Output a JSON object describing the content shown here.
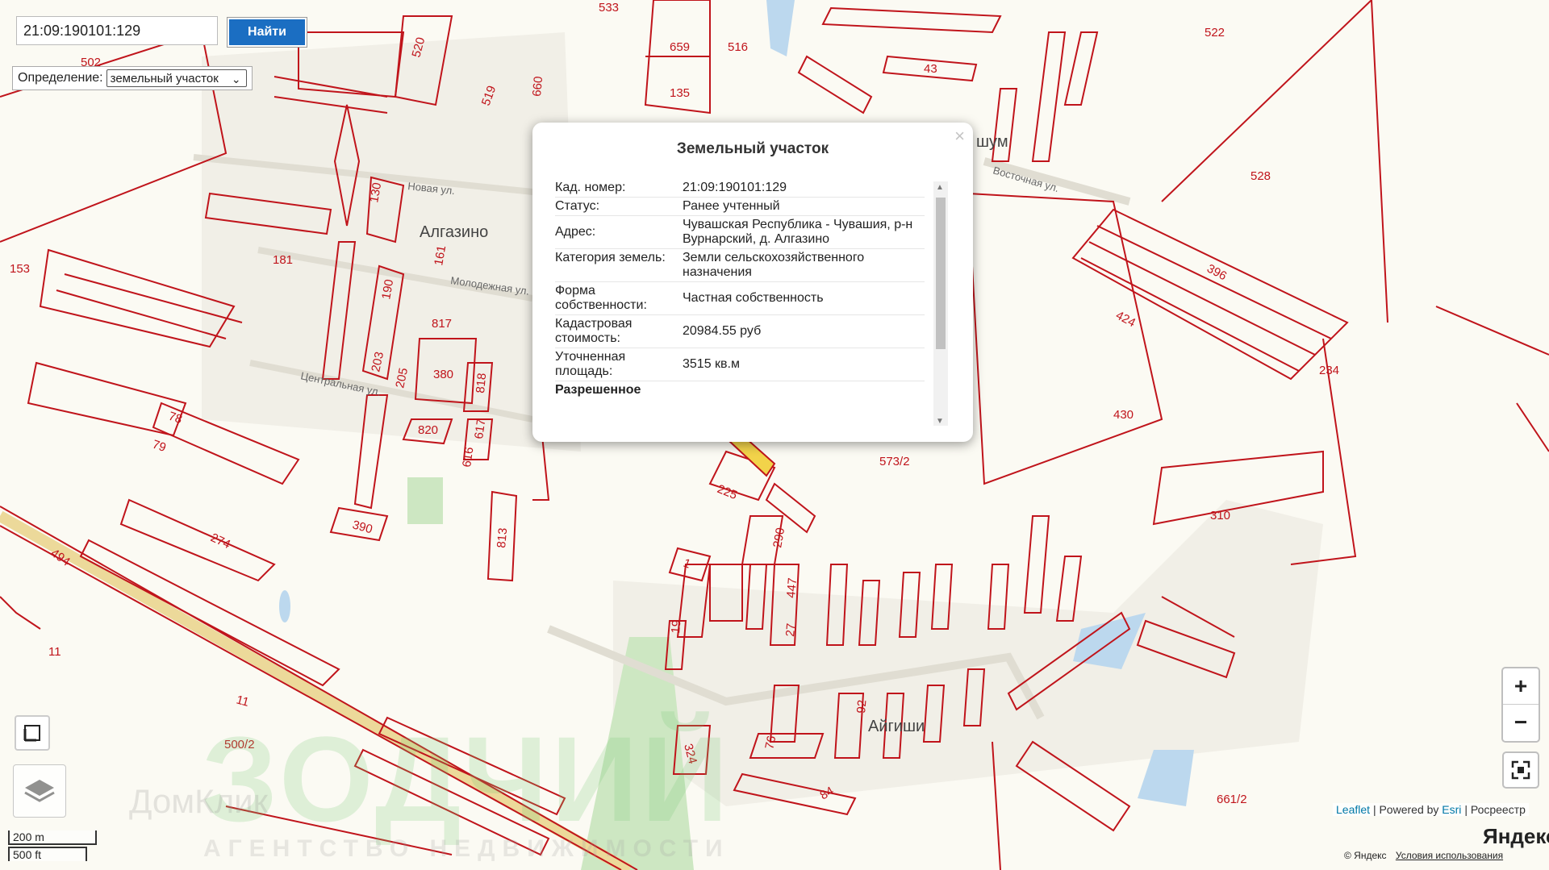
{
  "search": {
    "value": "21:09:190101:129",
    "button_label": "Найти"
  },
  "definition": {
    "label": "Определение:",
    "selected": "земельный участок"
  },
  "popup": {
    "title": "Земельный участок",
    "close": "×",
    "rows": [
      {
        "key": "Кад. номер:",
        "value": "21:09:190101:129"
      },
      {
        "key": "Статус:",
        "value": "Ранее учтенный"
      },
      {
        "key": "Адрес:",
        "value": "Чувашская Республика - Чувашия, р-н Вурнарский, д. Алгазино"
      },
      {
        "key": "Категория земель:",
        "value": "Земли сельскохозяйственного назначения"
      },
      {
        "key": "Форма собственности:",
        "value": "Частная собственность"
      },
      {
        "key": "Кадастровая стоимость:",
        "value": "20984.55 руб"
      },
      {
        "key": "Уточненная площадь:",
        "value": "3515 кв.м"
      },
      {
        "key": "Разрешенное",
        "value": ""
      }
    ]
  },
  "map": {
    "places": {
      "algazino": "Алгазино",
      "aygishi": "Айгиши",
      "shum": "шум"
    },
    "streets": {
      "molodezhnaya": "Молодежная ул.",
      "tsentralnaya": "Центральная ул.",
      "vostochnaya": "Восточная ул.",
      "other": "Новая ул."
    },
    "parcel_labels": [
      "533",
      "659",
      "516",
      "135",
      "43",
      "522",
      "502",
      "520",
      "519",
      "660",
      "528",
      "153",
      "181",
      "130",
      "161",
      "190",
      "817",
      "203",
      "205",
      "380",
      "818",
      "396",
      "424",
      "234",
      "430",
      "78",
      "79",
      "820",
      "616",
      "617",
      "274",
      "390",
      "813",
      "573/2",
      "225",
      "290",
      "310",
      "494",
      "1",
      "447",
      "27",
      "19",
      "11",
      "11",
      "500/2",
      "324",
      "76",
      "92",
      "84",
      "661/2"
    ]
  },
  "zoom": {
    "in": "+",
    "out": "−"
  },
  "scale": {
    "metric": "200 m",
    "imperial": "500 ft"
  },
  "attribution": {
    "leaflet": "Leaflet",
    "powered": "Powered by",
    "esri": "Esri",
    "rosreestr": "Росреестр",
    "yandex_logo": "Яндекс",
    "yandex_copy": "© Яндекс",
    "terms": "Условия использования"
  },
  "watermark": {
    "main": "ЗОДЧИЙ",
    "sub": "АГЕНТСТВО НЕДВИЖИМОСТИ",
    "partner": "ДомКлик"
  },
  "colors": {
    "parcel": "#c0141b",
    "accent": "#1b6ec2",
    "map_bg": "#fbfaf3"
  }
}
